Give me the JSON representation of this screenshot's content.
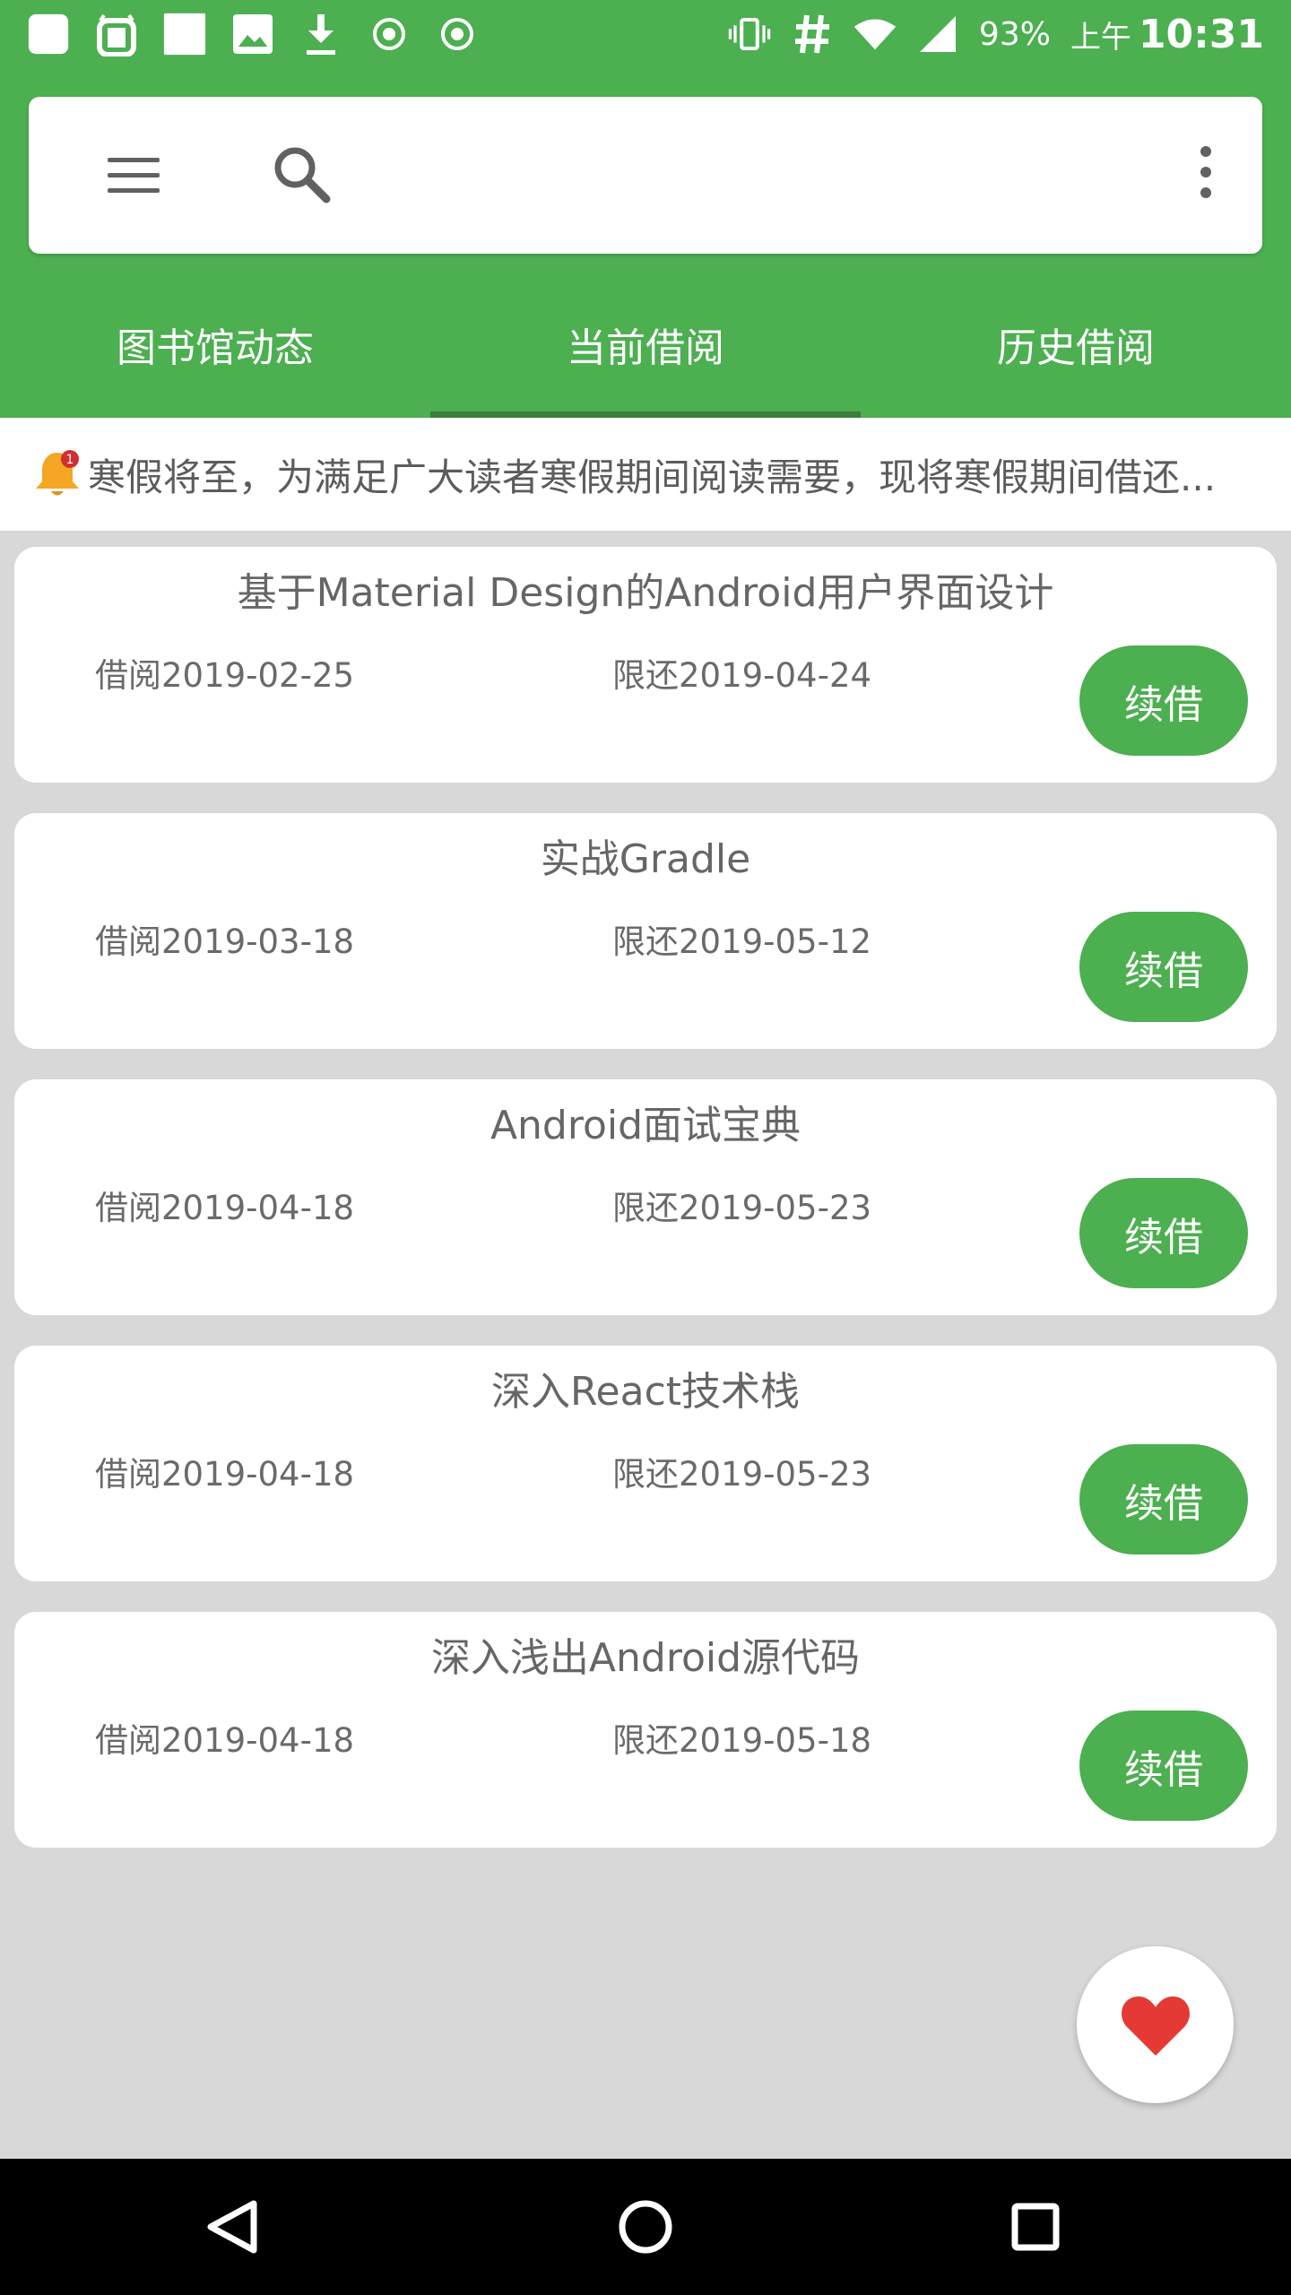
{
  "status_bar": {
    "left_icons": [
      "app-square-icon",
      "android-robot-icon",
      "square-icon",
      "image-icon",
      "download-icon",
      "radio-dot-icon",
      "radio-dot-icon"
    ],
    "right_icons": [
      "vibrate-icon",
      "hash-icon",
      "wifi-icon",
      "cellular-signal-icon"
    ],
    "battery": "93%",
    "ampm": "上午",
    "time": "10:31"
  },
  "search_bar": {
    "menu_icon": "hamburger-menu-icon",
    "search_icon": "search-icon",
    "placeholder": "",
    "value": "",
    "overflow_icon": "more-vertical-icon"
  },
  "tabs": [
    {
      "label": "图书馆动态",
      "active": false
    },
    {
      "label": "当前借阅",
      "active": true
    },
    {
      "label": "历史借阅",
      "active": false
    }
  ],
  "notice": {
    "icon": "bell-icon",
    "badge": "1",
    "text": "寒假将至，为满足广大读者寒假期间阅读需要，现将寒假期间借还..."
  },
  "books": [
    {
      "title": "基于Material Design的Android用户界面设计",
      "borrowed": "借阅2019-02-25",
      "due": "限还2019-04-24",
      "renew_label": "续借"
    },
    {
      "title": "实战Gradle",
      "borrowed": "借阅2019-03-18",
      "due": "限还2019-05-12",
      "renew_label": "续借"
    },
    {
      "title": "Android面试宝典",
      "borrowed": "借阅2019-04-18",
      "due": "限还2019-05-23",
      "renew_label": "续借"
    },
    {
      "title": "深入React技术栈",
      "borrowed": "借阅2019-04-18",
      "due": "限还2019-05-23",
      "renew_label": "续借"
    },
    {
      "title": "深入浅出Android源代码",
      "borrowed": "借阅2019-04-18",
      "due": "限还2019-05-18",
      "renew_label": "续借"
    }
  ],
  "fab": {
    "icon": "heart-icon"
  },
  "nav_bar": {
    "icons": [
      "back-triangle-icon",
      "home-circle-icon",
      "recents-square-icon"
    ]
  },
  "colors": {
    "primary": "#4caf50",
    "tab_indicator": "#3a7d3d",
    "background": "#d9d8d9",
    "heart": "#e53935",
    "bell": "#f5a623",
    "badge": "#d32f2f",
    "nav_bar": "#000000"
  }
}
